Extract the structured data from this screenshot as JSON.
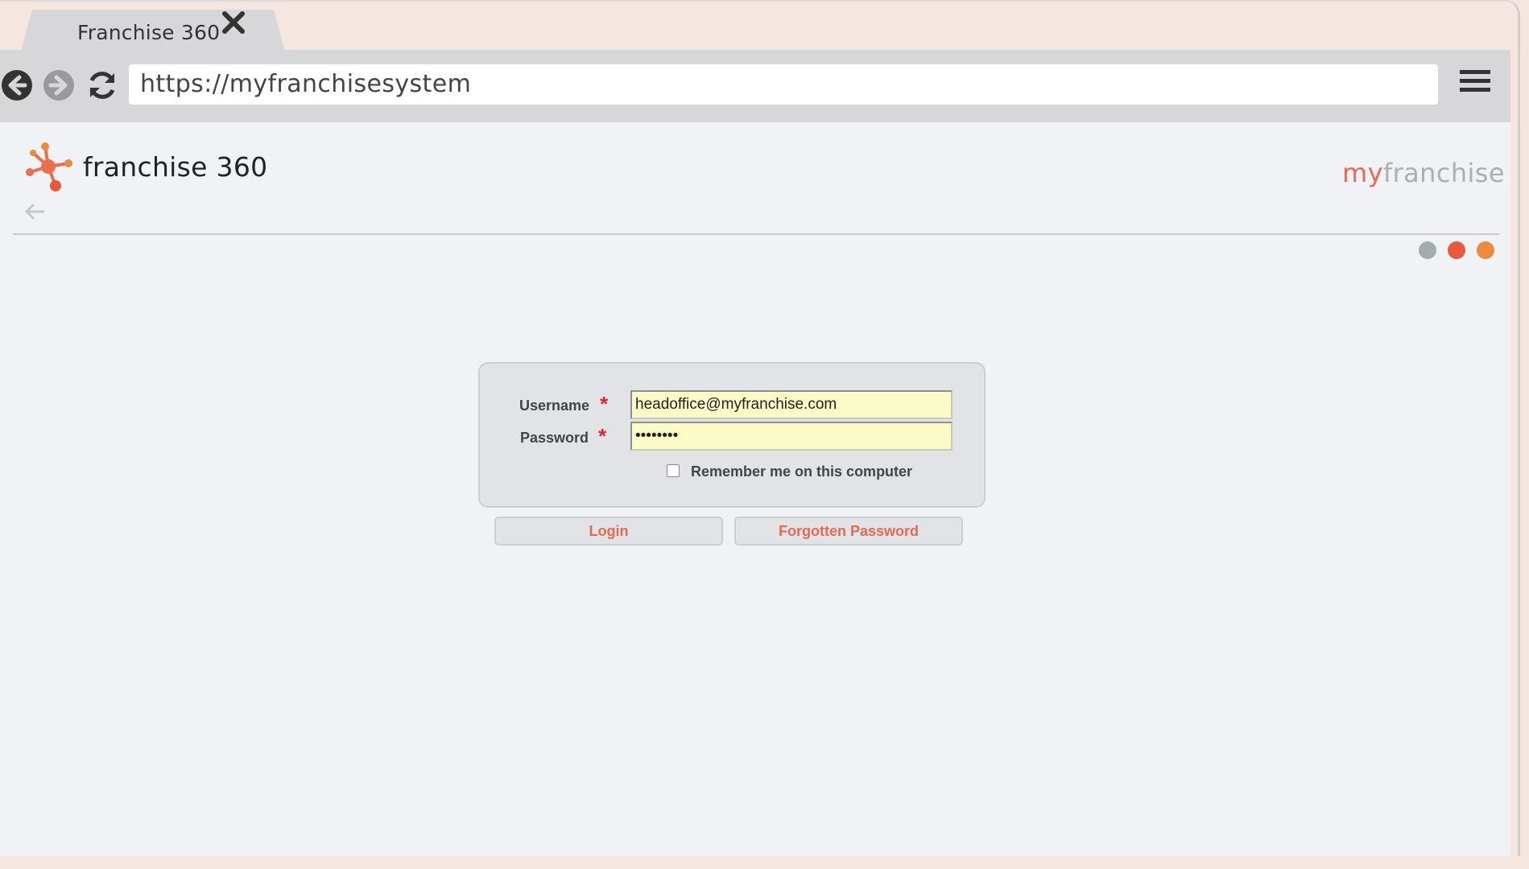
{
  "browser": {
    "tab_title": "Franchise 360",
    "url": "https://myfranchisesystem",
    "icons": [
      "back-icon",
      "forward-icon",
      "refresh-icon",
      "close-icon",
      "hamburger-menu-icon"
    ]
  },
  "header": {
    "logo_text": "franchise 360",
    "brand_prefix": "my",
    "brand_suffix": "franchise",
    "brand_colors": {
      "prefix": "#e66a4f",
      "suffix": "#a9b0b2"
    },
    "status_dot_colors": [
      "#a3adaf",
      "#e8583a",
      "#ec8a3e"
    ]
  },
  "login": {
    "username_label": "Username",
    "password_label": "Password",
    "required_marker": "*",
    "username_value": "headoffice@myfranchise.com",
    "password_value": "••••••••",
    "remember_label": "Remember me on this computer",
    "remember_checked": false,
    "login_button": "Login",
    "forgot_button": "Forgotten Password"
  }
}
